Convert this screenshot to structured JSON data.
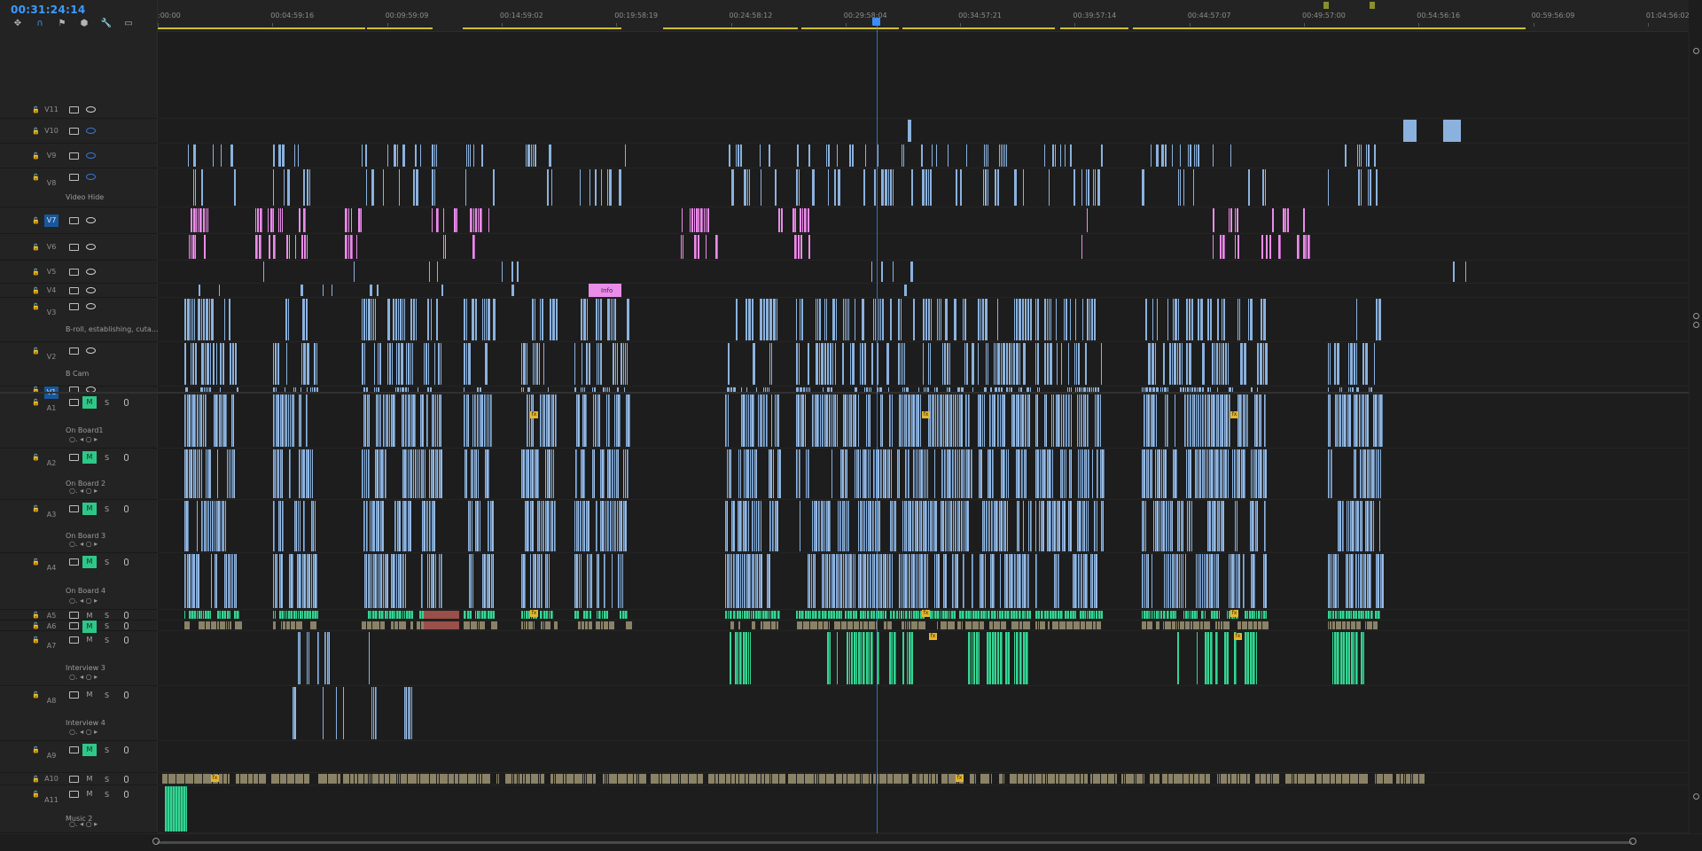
{
  "timecode": "00:31:24:14",
  "tools": [
    {
      "name": "insert-sequence-icon"
    },
    {
      "name": "snap-magnet-icon"
    },
    {
      "name": "linked-selection-icon"
    },
    {
      "name": "add-marker-icon"
    },
    {
      "name": "wrench-settings-icon"
    },
    {
      "name": "captions-icon"
    }
  ],
  "ruler": {
    "labels": [
      ":00:00",
      "00:04:59:16",
      "00:09:59:09",
      "00:14:59:02",
      "00:19:58:19",
      "00:24:58:12",
      "00:29:58:04",
      "00:34:57:21",
      "00:39:57:14",
      "00:44:57:07",
      "00:49:57:00",
      "00:54:56:16",
      "00:59:56:09",
      "01:04:56:02"
    ]
  },
  "video_tracks": [
    {
      "id": "V11",
      "label": "",
      "eye": "on"
    },
    {
      "id": "V10",
      "label": "",
      "eye": "off"
    },
    {
      "id": "V9",
      "label": "",
      "eye": "off"
    },
    {
      "id": "V8",
      "label": "Video Hide",
      "eye": "off"
    },
    {
      "id": "V7",
      "label": "",
      "eye": "on",
      "selected": true
    },
    {
      "id": "V6",
      "label": "",
      "eye": "on"
    },
    {
      "id": "V5",
      "label": "",
      "eye": "on"
    },
    {
      "id": "V4",
      "label": "",
      "eye": "on"
    },
    {
      "id": "V3",
      "label": "B-roll, establishing, cuta...",
      "eye": "on"
    },
    {
      "id": "V2",
      "label": "B Cam",
      "eye": "on"
    },
    {
      "id": "V1",
      "label": "",
      "eye": "on",
      "selected": true
    }
  ],
  "audio_tracks": [
    {
      "id": "A1",
      "label": "On Board1",
      "mute": true
    },
    {
      "id": "A2",
      "label": "On Board 2",
      "mute": true
    },
    {
      "id": "A3",
      "label": "On Board 3",
      "mute": true
    },
    {
      "id": "A4",
      "label": "On Board 4",
      "mute": true
    },
    {
      "id": "A5",
      "label": "",
      "mute": false
    },
    {
      "id": "A6",
      "label": "",
      "mute": true
    },
    {
      "id": "A7",
      "label": "Interview 3",
      "mute": false
    },
    {
      "id": "A8",
      "label": "Interview 4",
      "mute": false
    },
    {
      "id": "A9",
      "label": "",
      "mute": true
    },
    {
      "id": "A10",
      "label": "",
      "mute": false
    },
    {
      "id": "A11",
      "label": "Music 2",
      "mute": false
    }
  ],
  "button_labels": {
    "mute": "M",
    "solo": "S"
  },
  "info_clip_label": "Info",
  "colors": {
    "timecode": "#3d9bff",
    "video_clip": "#8bb2de",
    "adjustment_clip": "#e98de8",
    "audio_clip_green": "#36d494",
    "playhead": "#3c8dfa",
    "track_selected": "#19579a",
    "fx_badge": "#e5b52e"
  }
}
